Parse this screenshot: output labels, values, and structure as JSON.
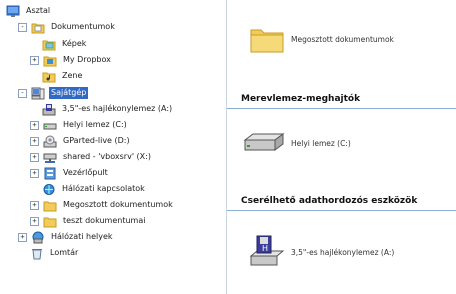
{
  "tree": {
    "items": [
      {
        "label": "Asztal",
        "toggle": "",
        "icon": "desktop-icon"
      },
      {
        "label": "Dokumentumok",
        "toggle": "-",
        "icon": "documents-folder-icon"
      },
      {
        "label": "Képek",
        "toggle": "",
        "icon": "pictures-folder-icon"
      },
      {
        "label": "My Dropbox",
        "toggle": "+",
        "icon": "dropbox-folder-icon"
      },
      {
        "label": "Zene",
        "toggle": "",
        "icon": "music-folder-icon"
      },
      {
        "label": "Sajátgép",
        "toggle": "-",
        "icon": "my-computer-icon"
      },
      {
        "label": "3,5\"-es hajlékonylemez (A:)",
        "toggle": "",
        "icon": "floppy-drive-icon"
      },
      {
        "label": "Helyi lemez (C:)",
        "toggle": "+",
        "icon": "hard-disk-icon"
      },
      {
        "label": "GParted-live (D:)",
        "toggle": "+",
        "icon": "cd-drive-icon"
      },
      {
        "label": "shared - 'vboxsrv' (X:)",
        "toggle": "+",
        "icon": "network-drive-icon"
      },
      {
        "label": "Vezérlőpult",
        "toggle": "+",
        "icon": "control-panel-icon"
      },
      {
        "label": "Hálózati kapcsolatok",
        "toggle": "",
        "icon": "network-connections-icon"
      },
      {
        "label": "Megosztott dokumentumok",
        "toggle": "+",
        "icon": "shared-folder-icon"
      },
      {
        "label": "teszt dokumentumai",
        "toggle": "+",
        "icon": "user-folder-icon"
      },
      {
        "label": "Hálózati helyek",
        "toggle": "+",
        "icon": "network-places-icon"
      },
      {
        "label": "Lomtár",
        "toggle": "",
        "icon": "recycle-bin-icon"
      }
    ]
  },
  "content": {
    "shared_folder_label": "Megosztott dokumentumok",
    "group_hard_drives": "Merevlemez-meghajtók",
    "hard_disk_label": "Helyi lemez (C:)",
    "group_removable": "Cserélhető adathordozós eszközök",
    "floppy_label": "3,5\"-es hajlékonylemez (A:)"
  },
  "colors": {
    "selection": "#316ac5",
    "folder": "#f1cc5a",
    "group_line": "#8bb0d8"
  }
}
